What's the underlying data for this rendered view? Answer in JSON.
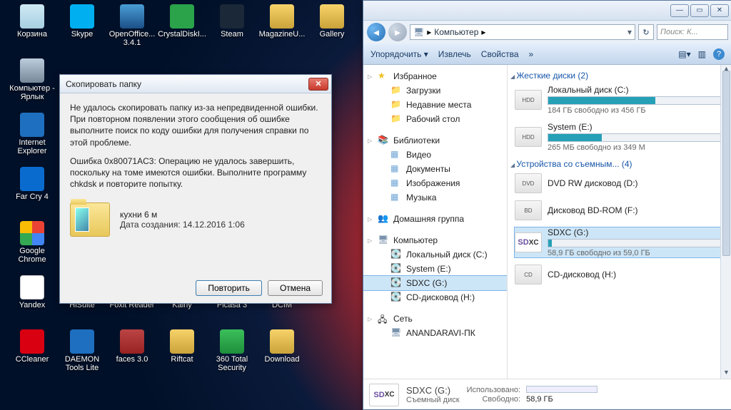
{
  "desktop_icons": [
    {
      "id": "recycle-bin",
      "label": "Корзина",
      "cls": "ic-bin"
    },
    {
      "id": "skype",
      "label": "Skype",
      "cls": "ic-skype"
    },
    {
      "id": "openoffice",
      "label": "OpenOffice... 3.4.1",
      "cls": "ic-oo"
    },
    {
      "id": "crystaldisk",
      "label": "CrystalDiskI...",
      "cls": "ic-cdi"
    },
    {
      "id": "steam",
      "label": "Steam",
      "cls": "ic-steam"
    },
    {
      "id": "magazine",
      "label": "MagazineU...",
      "cls": "ic-mag"
    },
    {
      "id": "gallery",
      "label": "Gallery",
      "cls": "ic-gal"
    },
    {
      "id": "computer-shortcut",
      "label": "Компьютер - Ярлык",
      "cls": "ic-pc"
    },
    {
      "id": "blank1",
      "label": "",
      "cls": ""
    },
    {
      "id": "blank2",
      "label": "",
      "cls": ""
    },
    {
      "id": "blank3",
      "label": "",
      "cls": ""
    },
    {
      "id": "blank4",
      "label": "",
      "cls": ""
    },
    {
      "id": "blank5",
      "label": "",
      "cls": ""
    },
    {
      "id": "blank6",
      "label": "",
      "cls": ""
    },
    {
      "id": "ie",
      "label": "Internet Explorer",
      "cls": "ic-ie"
    },
    {
      "id": "blank7",
      "label": "",
      "cls": ""
    },
    {
      "id": "blank8",
      "label": "",
      "cls": ""
    },
    {
      "id": "blank9",
      "label": "",
      "cls": ""
    },
    {
      "id": "blank10",
      "label": "",
      "cls": ""
    },
    {
      "id": "blank11",
      "label": "",
      "cls": ""
    },
    {
      "id": "blank12",
      "label": "",
      "cls": ""
    },
    {
      "id": "farcry4",
      "label": "Far Cry 4",
      "cls": "ic-fc"
    },
    {
      "id": "blank13",
      "label": "",
      "cls": ""
    },
    {
      "id": "blank14",
      "label": "",
      "cls": ""
    },
    {
      "id": "blank15",
      "label": "",
      "cls": ""
    },
    {
      "id": "blank16",
      "label": "",
      "cls": ""
    },
    {
      "id": "blank17",
      "label": "",
      "cls": ""
    },
    {
      "id": "blank18",
      "label": "",
      "cls": ""
    },
    {
      "id": "chrome",
      "label": "Google Chrome",
      "cls": "ic-gc"
    },
    {
      "id": "blank19",
      "label": "",
      "cls": ""
    },
    {
      "id": "blank20",
      "label": "",
      "cls": ""
    },
    {
      "id": "blank21",
      "label": "",
      "cls": ""
    },
    {
      "id": "blank22",
      "label": "",
      "cls": ""
    },
    {
      "id": "blank23",
      "label": "",
      "cls": ""
    },
    {
      "id": "blank24",
      "label": "",
      "cls": ""
    },
    {
      "id": "yandex",
      "label": "Yandex",
      "cls": "ic-ya"
    },
    {
      "id": "hisuite",
      "label": "HiSuite",
      "cls": "ic-hs"
    },
    {
      "id": "foxit",
      "label": "Foxit Reader",
      "cls": "ic-fx"
    },
    {
      "id": "kainy",
      "label": "Kainy",
      "cls": "ic-ka"
    },
    {
      "id": "picasa",
      "label": "Picasa 3",
      "cls": "ic-pi"
    },
    {
      "id": "dcim",
      "label": "DCIM",
      "cls": "ic-dc"
    },
    {
      "id": "blank25",
      "label": "",
      "cls": ""
    },
    {
      "id": "ccleaner",
      "label": "CCleaner",
      "cls": "ic-cc"
    },
    {
      "id": "daemon",
      "label": "DAEMON Tools Lite",
      "cls": "ic-dt"
    },
    {
      "id": "faces",
      "label": "faces 3.0",
      "cls": "ic-fa"
    },
    {
      "id": "riftcat",
      "label": "Riftcat",
      "cls": "ic-rc"
    },
    {
      "id": "360ts",
      "label": "360 Total Security",
      "cls": "ic-360"
    },
    {
      "id": "download",
      "label": "Download",
      "cls": "ic-dl"
    }
  ],
  "explorer": {
    "address": {
      "location": "Компьютер",
      "chevron": "▸"
    },
    "search_placeholder": "Поиск: К...",
    "toolbar": {
      "organize": "Упорядочить",
      "extract": "Извлечь",
      "properties": "Свойства"
    },
    "nav": {
      "favorites": {
        "head": "Избранное",
        "items": [
          "Загрузки",
          "Недавние места",
          "Рабочий стол"
        ]
      },
      "libraries": {
        "head": "Библиотеки",
        "items": [
          "Видео",
          "Документы",
          "Изображения",
          "Музыка"
        ]
      },
      "homegroup": {
        "head": "Домашняя группа"
      },
      "computer": {
        "head": "Компьютер",
        "items": [
          "Локальный диск (C:)",
          "System (E:)",
          "SDXC (G:)",
          "CD-дисковод (H:)"
        ]
      },
      "network": {
        "head": "Сеть",
        "items": [
          "ANANDARAVI-ПК"
        ]
      }
    },
    "content": {
      "hard_drives_header": "Жесткие диски (2)",
      "removable_header": "Устройства со съемным... (4)",
      "drives": [
        {
          "name": "Локальный диск (C:)",
          "sub": "184 ГБ свободно из 456 ГБ",
          "fill": 60,
          "icon": "HDD"
        },
        {
          "name": "System (E:)",
          "sub": "265 МБ свободно из 349 М",
          "fill": 30,
          "icon": "HDD"
        }
      ],
      "removables": [
        {
          "name": "DVD RW дисковод (D:)",
          "sub": "",
          "icon": "DVD"
        },
        {
          "name": "Дисковод BD-ROM (F:)",
          "sub": "",
          "icon": "BD"
        },
        {
          "name": "SDXC (G:)",
          "sub": "58,9 ГБ свободно из 59,0 ГБ",
          "icon": "SDXC",
          "selected": true,
          "fill": 2
        },
        {
          "name": "CD-дисковод (H:)",
          "sub": "",
          "icon": "CD"
        }
      ]
    },
    "details": {
      "title": "SDXC (G:)",
      "subtitle": "Съемный диск",
      "used_label": "Использовано:",
      "free_label": "Свободно:",
      "free_value": "58,9 ГБ"
    }
  },
  "dialog": {
    "title": "Скопировать папку",
    "p1": "Не удалось скопировать папку из-за непредвиденной ошибки. При повторном появлении этого сообщения об ошибке выполните поиск по коду ошибки для получения справки по этой проблеме.",
    "p2": "Ошибка 0x80071AC3: Операцию не удалось завершить, поскольку на томе имеются ошибки. Выполните программу chkdsk и повторите попытку.",
    "folder_name": "кухни 6 м",
    "folder_date": "Дата создания: 14.12.2016 1:06",
    "retry": "Повторить",
    "cancel": "Отмена"
  }
}
